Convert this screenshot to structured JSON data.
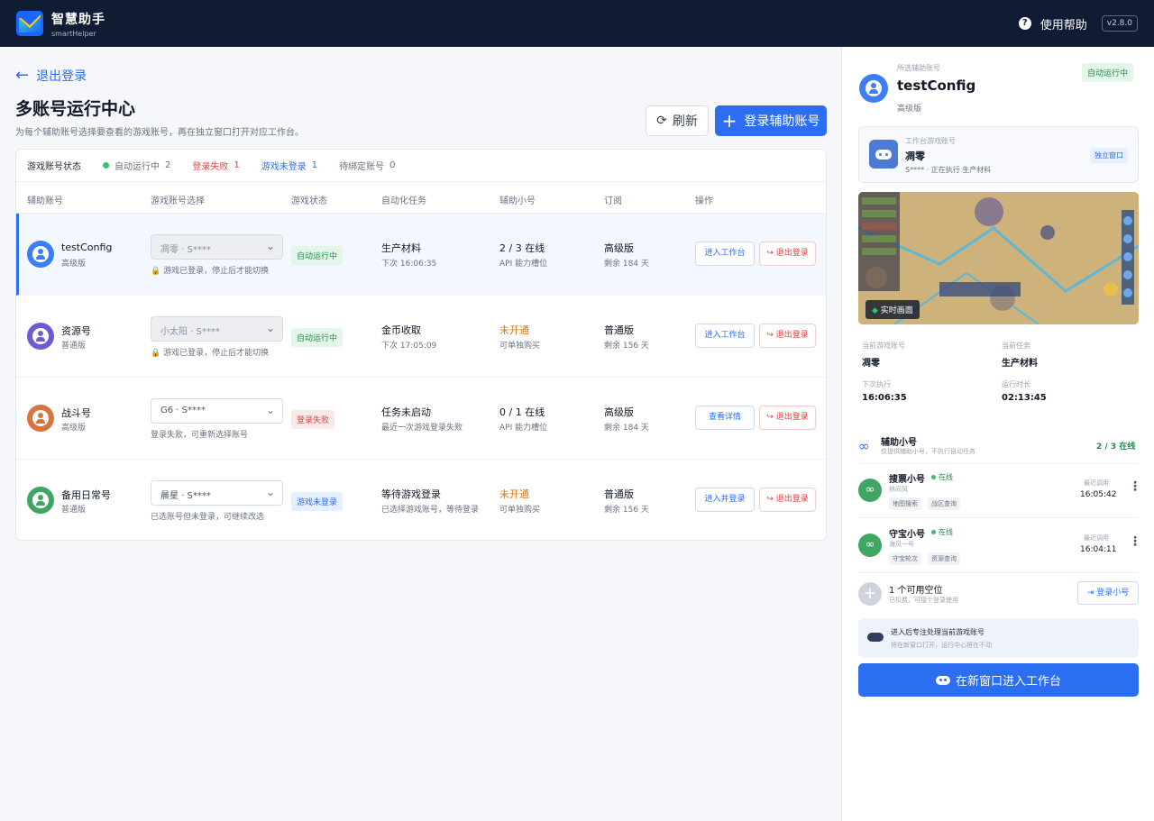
{
  "app": {
    "name": "智慧助手",
    "subname": "smartHelper",
    "help": "使用帮助",
    "version": "v2.8.0"
  },
  "page": {
    "back": "退出登录",
    "title": "多账号运行中心",
    "desc": "为每个辅助账号选择要查看的游戏账号，再在独立窗口打开对应工作台。",
    "refresh": "刷新",
    "login": "登录辅助账号"
  },
  "status": {
    "label": "游戏账号状态",
    "running_label": "自动运行中",
    "running_count": "2",
    "failed_label": "登录失败",
    "failed_count": "1",
    "notlogged_label": "游戏未登录",
    "notlogged_count": "1",
    "pending_label": "待绑定账号",
    "pending_count": "0"
  },
  "columns": [
    "辅助账号",
    "游戏账号选择",
    "游戏状态",
    "自动化任务",
    "辅助小号",
    "订阅",
    "操作"
  ],
  "rows": [
    {
      "name": "testConfig",
      "tier": "高级版",
      "avatar_color": "#3c7ff5",
      "game": "凋零 · S****",
      "note": "🔒 游戏已登录，停止后才能切换",
      "status": "自动运行中",
      "task": "生产材料",
      "task_sub": "下次 16:06:35",
      "sub": "2 / 3 在线",
      "sub_sub": "API 能力槽位",
      "plan": "高级版",
      "plan_sub": "剩余 184 天",
      "op1": "进入工作台",
      "op2": "↪ 退出登录"
    },
    {
      "name": "资源号",
      "tier": "普通版",
      "avatar_color": "#6f5bd1",
      "game": "小太阳 · S****",
      "note": "🔒 游戏已登录，停止后才能切换",
      "status": "自动运行中",
      "task": "金币收取",
      "task_sub": "下次 17:05:09",
      "sub": "未开通",
      "sub_sub": "可单独购买",
      "plan": "普通版",
      "plan_sub": "剩余 156 天",
      "op1": "进入工作台",
      "op2": "↪ 退出登录"
    },
    {
      "name": "战斗号",
      "tier": "高级版",
      "avatar_color": "#d9733f",
      "game": "G6 · S****",
      "note": "登录失败，可重新选择账号",
      "status": "登录失败",
      "task": "任务未启动",
      "task_sub": "最近一次游戏登录失败",
      "sub": "0 / 1 在线",
      "sub_sub": "API 能力槽位",
      "plan": "高级版",
      "plan_sub": "剩余 184 天",
      "op1": "查看详情",
      "op2": "↪ 退出登录"
    },
    {
      "name": "备用日常号",
      "tier": "普通版",
      "avatar_color": "#3fa562",
      "game": "晨星 · S****",
      "note": "已选账号但未登录，可继续改选",
      "status": "游戏未登录",
      "task": "等待游戏登录",
      "task_sub": "已选择游戏账号，等待登录",
      "sub": "未开通",
      "sub_sub": "可单独购买",
      "plan": "普通版",
      "plan_sub": "剩余 156 天",
      "op1": "进入并登录",
      "op2": "↪ 退出登录"
    }
  ],
  "panel": {
    "label": "所选辅助账号",
    "name": "testConfig",
    "tier": "高级版",
    "badge": "自动运行中",
    "game_label": "工作台游戏账号",
    "game_name": "凋零",
    "game_sub": "S**** · 正在执行 生产材料",
    "game_btn": "独立窗口",
    "live": "实时画面",
    "cur_game_label": "当前游戏账号",
    "cur_game": "凋零",
    "cur_task_label": "当前任务",
    "cur_task": "生产材料",
    "next_label": "下次执行",
    "next": "16:06:35",
    "run_label": "运行时长",
    "run": "02:13:45",
    "assist_title": "辅助小号",
    "assist_sub": "仅提供辅助小号，不执行自动任务",
    "assist_count": "2 / 3 在线",
    "subs": [
      {
        "name": "搜票小号",
        "online": "在线",
        "who": "林间风",
        "tags": [
          "地图搜索",
          "战区查询"
        ],
        "recent_label": "最近调用",
        "recent": "16:05:42"
      },
      {
        "name": "守宝小号",
        "online": "在线",
        "who": "海风一号",
        "tags": [
          "守宝轮次",
          "资源查询"
        ],
        "recent_label": "最近调用",
        "recent": "16:04:11"
      }
    ],
    "slot_name": "1 个可用空位",
    "slot_sub": "已扣费，可接个登录使用",
    "slot_btn": "登录小号",
    "tip_title": "进入后专注处理当前游戏账号",
    "tip_sub": "将在新窗口打开，运行中心将在不动",
    "enter": "在新窗口进入工作台"
  }
}
